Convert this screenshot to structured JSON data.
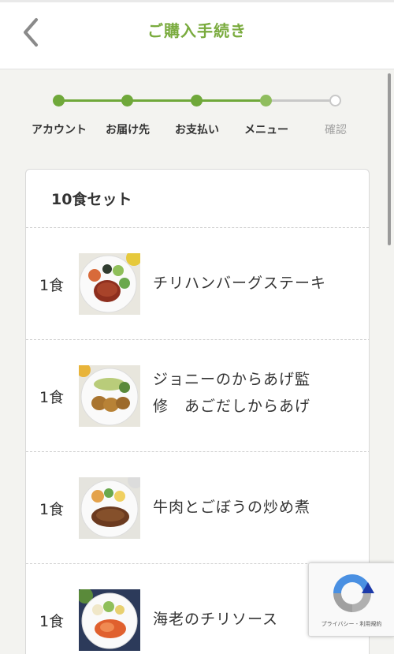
{
  "header": {
    "title": "ご購入手続き"
  },
  "stepper": {
    "steps": [
      {
        "label": "アカウント",
        "state": "done"
      },
      {
        "label": "お届け先",
        "state": "done"
      },
      {
        "label": "お支払い",
        "state": "done"
      },
      {
        "label": "メニュー",
        "state": "current"
      },
      {
        "label": "確認",
        "state": "todo"
      }
    ],
    "colors": {
      "done": "#6fa83a",
      "current": "#8fbd5e",
      "todo": "#c8c8c8"
    }
  },
  "set": {
    "title": "10食セット",
    "items": [
      {
        "qty": "1食",
        "name": "チリハンバーグステーキ",
        "image_icon": "hamburg-steak-plate"
      },
      {
        "qty": "1食",
        "name_line1": "ジョニーのからあげ監",
        "name_line2": "修　あごだしからあげ",
        "image_icon": "karaage-plate"
      },
      {
        "qty": "1食",
        "name": "牛肉とごぼうの炒め煮",
        "image_icon": "beef-burdock-plate"
      },
      {
        "qty": "1食",
        "name": "海老のチリソース",
        "image_icon": "shrimp-chili-plate"
      }
    ]
  },
  "recaptcha": {
    "links": "プライバシー - 利用規約"
  }
}
